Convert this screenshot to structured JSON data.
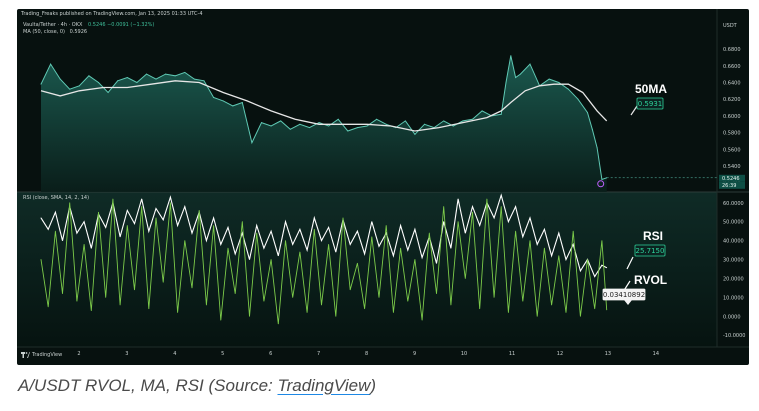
{
  "header": {
    "publish_line": "Trading_Freaks published on TradingView.com, Jan 13, 2025 01:33 UTC-4",
    "symbol_line": "Vaulta/Tether · 4h · OKX",
    "symbol_values": "0.5246 −0.0091 (−1.32%)",
    "ma_line": "MA (50, close, 0)",
    "ma_value": "0.5926",
    "rsi_line": "RSI (close, SMA, 14, 2, 14)",
    "currency": "USDT"
  },
  "annotations": {
    "ma_title": "50MA",
    "ma_box": "0.5931",
    "rsi_title": "RSI",
    "rsi_box": "25.7150",
    "rvol_title": "RVOL",
    "rvol_box": "0.03410892"
  },
  "price_badges": [
    "0.5246",
    "26:39"
  ],
  "footer": {
    "logo_text": "TradingView"
  },
  "caption": {
    "text": "A/USDT RVOL, MA, RSI (Source: ",
    "link": "TradingView",
    "close": ")"
  },
  "colors": {
    "background": "#07110f",
    "price_line": "#5fc9b4",
    "price_fill": "#1c5e53",
    "ma_line": "#e6e6e6",
    "rsi_line": "#ffffff",
    "rvol_line": "#7ccb4a",
    "caption_link_underline": "#1e88e5"
  },
  "chart_data": [
    {
      "type": "area",
      "name": "price",
      "x": [
        1.2,
        1.4,
        1.6,
        1.8,
        2.0,
        2.2,
        2.4,
        2.6,
        2.8,
        3.0,
        3.2,
        3.4,
        3.6,
        3.8,
        4.0,
        4.2,
        4.4,
        4.6,
        4.8,
        5.0,
        5.2,
        5.4,
        5.6,
        5.8,
        6.0,
        6.2,
        6.4,
        6.6,
        6.8,
        7.0,
        7.2,
        7.4,
        7.6,
        7.8,
        8.0,
        8.2,
        8.4,
        8.6,
        8.8,
        9.0,
        9.2,
        9.4,
        9.6,
        9.8,
        10.0,
        10.2,
        10.4,
        10.6,
        10.8,
        10.9,
        11.0,
        11.1,
        11.2,
        11.4,
        11.6,
        11.8,
        12.0,
        12.2,
        12.4,
        12.6,
        12.7,
        12.8,
        12.9,
        13.0
      ],
      "values": [
        0.638,
        0.662,
        0.644,
        0.632,
        0.636,
        0.648,
        0.64,
        0.628,
        0.642,
        0.646,
        0.64,
        0.65,
        0.644,
        0.65,
        0.648,
        0.652,
        0.644,
        0.642,
        0.622,
        0.618,
        0.612,
        0.616,
        0.568,
        0.592,
        0.588,
        0.594,
        0.584,
        0.59,
        0.586,
        0.592,
        0.588,
        0.596,
        0.582,
        0.586,
        0.588,
        0.596,
        0.59,
        0.586,
        0.594,
        0.578,
        0.59,
        0.586,
        0.594,
        0.588,
        0.594,
        0.596,
        0.606,
        0.6,
        0.602,
        0.64,
        0.672,
        0.646,
        0.65,
        0.662,
        0.636,
        0.644,
        0.64,
        0.632,
        0.62,
        0.604,
        0.584,
        0.562,
        0.524,
        0.526
      ],
      "series": [
        {
          "name": "50MA",
          "x": [
            1.2,
            1.6,
            2.0,
            2.5,
            3.0,
            3.5,
            4.0,
            4.5,
            5.0,
            5.5,
            6.0,
            6.5,
            7.0,
            7.5,
            8.0,
            8.5,
            9.0,
            9.5,
            10.0,
            10.5,
            10.8,
            11.0,
            11.3,
            11.6,
            11.9,
            12.2,
            12.5,
            12.8,
            13.0
          ],
          "values": [
            0.63,
            0.624,
            0.63,
            0.634,
            0.634,
            0.638,
            0.642,
            0.64,
            0.628,
            0.618,
            0.606,
            0.596,
            0.59,
            0.59,
            0.59,
            0.588,
            0.582,
            0.586,
            0.592,
            0.598,
            0.606,
            0.616,
            0.63,
            0.636,
            0.638,
            0.638,
            0.628,
            0.606,
            0.594
          ]
        }
      ],
      "yticks": [
        "0.6800",
        "0.6600",
        "0.6400",
        "0.6200",
        "0.6000",
        "0.5800",
        "0.5600",
        "0.5400",
        "0.5200"
      ],
      "ylim": [
        0.515,
        0.692
      ],
      "xlim": [
        0.7,
        15.3
      ],
      "xticks": [
        "2",
        "3",
        "4",
        "5",
        "6",
        "7",
        "8",
        "9",
        "10",
        "11",
        "12",
        "13",
        "14"
      ]
    },
    {
      "type": "line",
      "name": "oscillators",
      "x": [
        1.2,
        1.35,
        1.5,
        1.65,
        1.8,
        1.95,
        2.1,
        2.25,
        2.4,
        2.55,
        2.7,
        2.85,
        3.0,
        3.15,
        3.3,
        3.45,
        3.6,
        3.75,
        3.9,
        4.05,
        4.2,
        4.35,
        4.5,
        4.65,
        4.8,
        4.95,
        5.1,
        5.25,
        5.4,
        5.55,
        5.7,
        5.85,
        6.0,
        6.15,
        6.3,
        6.45,
        6.6,
        6.75,
        6.9,
        7.05,
        7.2,
        7.35,
        7.5,
        7.65,
        7.8,
        7.95,
        8.1,
        8.25,
        8.4,
        8.55,
        8.7,
        8.85,
        9.0,
        9.15,
        9.3,
        9.45,
        9.6,
        9.75,
        9.9,
        10.05,
        10.2,
        10.35,
        10.5,
        10.65,
        10.8,
        10.95,
        11.1,
        11.25,
        11.4,
        11.55,
        11.7,
        11.85,
        12.0,
        12.15,
        12.3,
        12.45,
        12.6,
        12.75,
        12.9,
        13.0
      ],
      "series": [
        {
          "name": "RSI",
          "values": [
            52,
            46,
            55,
            40,
            58,
            44,
            50,
            36,
            54,
            47,
            60,
            42,
            56,
            49,
            62,
            45,
            57,
            51,
            63,
            48,
            58,
            44,
            55,
            40,
            52,
            38,
            47,
            33,
            44,
            30,
            48,
            36,
            45,
            32,
            50,
            38,
            46,
            35,
            52,
            40,
            47,
            34,
            51,
            38,
            45,
            33,
            50,
            37,
            44,
            32,
            48,
            35,
            46,
            31,
            42,
            28,
            50,
            36,
            62,
            44,
            58,
            48,
            60,
            52,
            64,
            50,
            58,
            42,
            52,
            38,
            46,
            32,
            44,
            30,
            38,
            24,
            30,
            21,
            27,
            25.7
          ]
        },
        {
          "name": "RVOL",
          "values": [
            30,
            5,
            45,
            12,
            60,
            8,
            38,
            3,
            55,
            10,
            62,
            6,
            48,
            14,
            58,
            4,
            52,
            18,
            60,
            2,
            40,
            15,
            56,
            6,
            48,
            -2,
            36,
            12,
            50,
            0,
            44,
            8,
            30,
            -4,
            40,
            10,
            34,
            2,
            46,
            6,
            38,
            0,
            52,
            14,
            28,
            4,
            42,
            10,
            48,
            2,
            36,
            8,
            30,
            -2,
            44,
            12,
            58,
            6,
            50,
            20,
            55,
            4,
            62,
            10,
            58,
            2,
            45,
            8,
            40,
            0,
            36,
            6,
            32,
            2,
            45,
            0,
            30,
            4,
            40,
            3.4
          ]
        }
      ],
      "yticks": [
        "60.0000",
        "50.0000",
        "40.0000",
        "30.0000",
        "20.0000",
        "10.0000",
        "0.0000",
        "-10.0000"
      ],
      "ylim": [
        -12,
        62
      ]
    }
  ]
}
